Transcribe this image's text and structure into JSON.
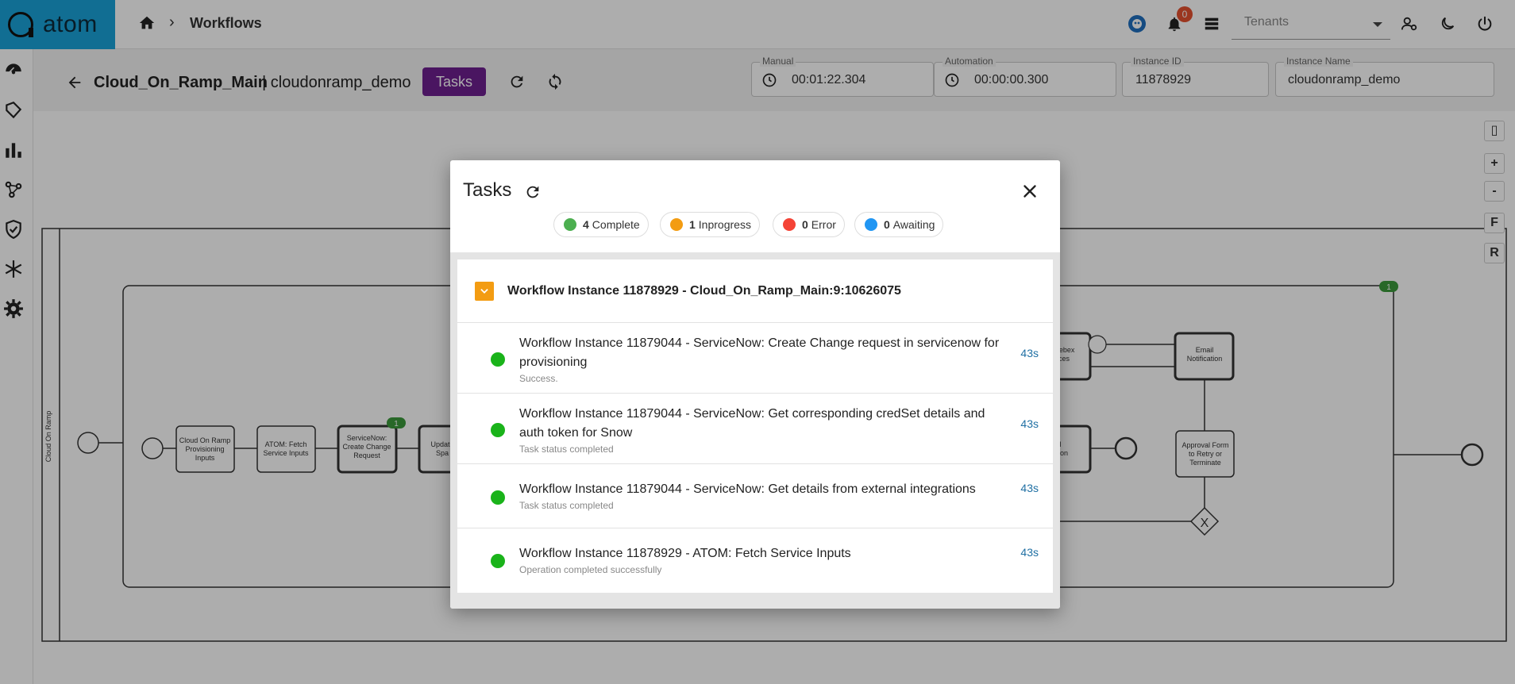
{
  "app": {
    "logo_text": "atom"
  },
  "breadcrumb": {
    "current": "Workflows"
  },
  "topbar": {
    "notification_count": "0",
    "tenants_placeholder": "Tenants"
  },
  "header": {
    "workflow_name": "Cloud_On_Ramp_Main",
    "workflow_subtitle": "| cloudonramp_demo",
    "tasks_button": "Tasks"
  },
  "fields": {
    "manual": {
      "label": "Manual",
      "value": "00:01:22.304"
    },
    "automation": {
      "label": "Automation",
      "value": "00:00:00.300"
    },
    "instance_id": {
      "label": "Instance ID",
      "value": "11878929"
    },
    "instance_name": {
      "label": "Instance Name",
      "value": "cloudonramp_demo"
    }
  },
  "canvas_controls": {
    "zoom_in": "+",
    "zoom_out": "-",
    "fit": "F",
    "reset": "R"
  },
  "diagram": {
    "pool_label": "Cloud On Ramp",
    "tasks": [
      "Cloud On Ramp Provisioning Inputs",
      "ATOM: Fetch Service Inputs",
      "ServiceNow: Create Change Request",
      "Update Spa",
      "ate Webex Spaces",
      "Email Notification",
      "ail ication",
      "Approval Form to Retry or Terminate"
    ],
    "badges": [
      "1",
      "1"
    ]
  },
  "modal": {
    "title": "Tasks",
    "status_counts": [
      {
        "count": "4",
        "label": "Complete",
        "color": "#4caf50"
      },
      {
        "count": "1",
        "label": "Inprogress",
        "color": "#f39c12"
      },
      {
        "count": "0",
        "label": "Error",
        "color": "#f44336"
      },
      {
        "count": "0",
        "label": "Awaiting",
        "color": "#2196f3"
      }
    ],
    "group_title": "Workflow Instance 11878929 - Cloud_On_Ramp_Main:9:10626075",
    "tasks": [
      {
        "title": "Workflow Instance 11879044 - ServiceNow: Create Change request in servicenow for provisioning",
        "status": "Success.",
        "time": "43s"
      },
      {
        "title": "Workflow Instance 11879044 - ServiceNow: Get corresponding credSet details and auth token for Snow",
        "status": "Task status completed",
        "time": "43s"
      },
      {
        "title": "Workflow Instance 11879044 - ServiceNow: Get details from external integrations",
        "status": "Task status completed",
        "time": "43s"
      },
      {
        "title": "Workflow Instance 11878929 - ATOM: Fetch Service Inputs",
        "status": "Operation completed successfully",
        "time": "43s"
      }
    ]
  }
}
